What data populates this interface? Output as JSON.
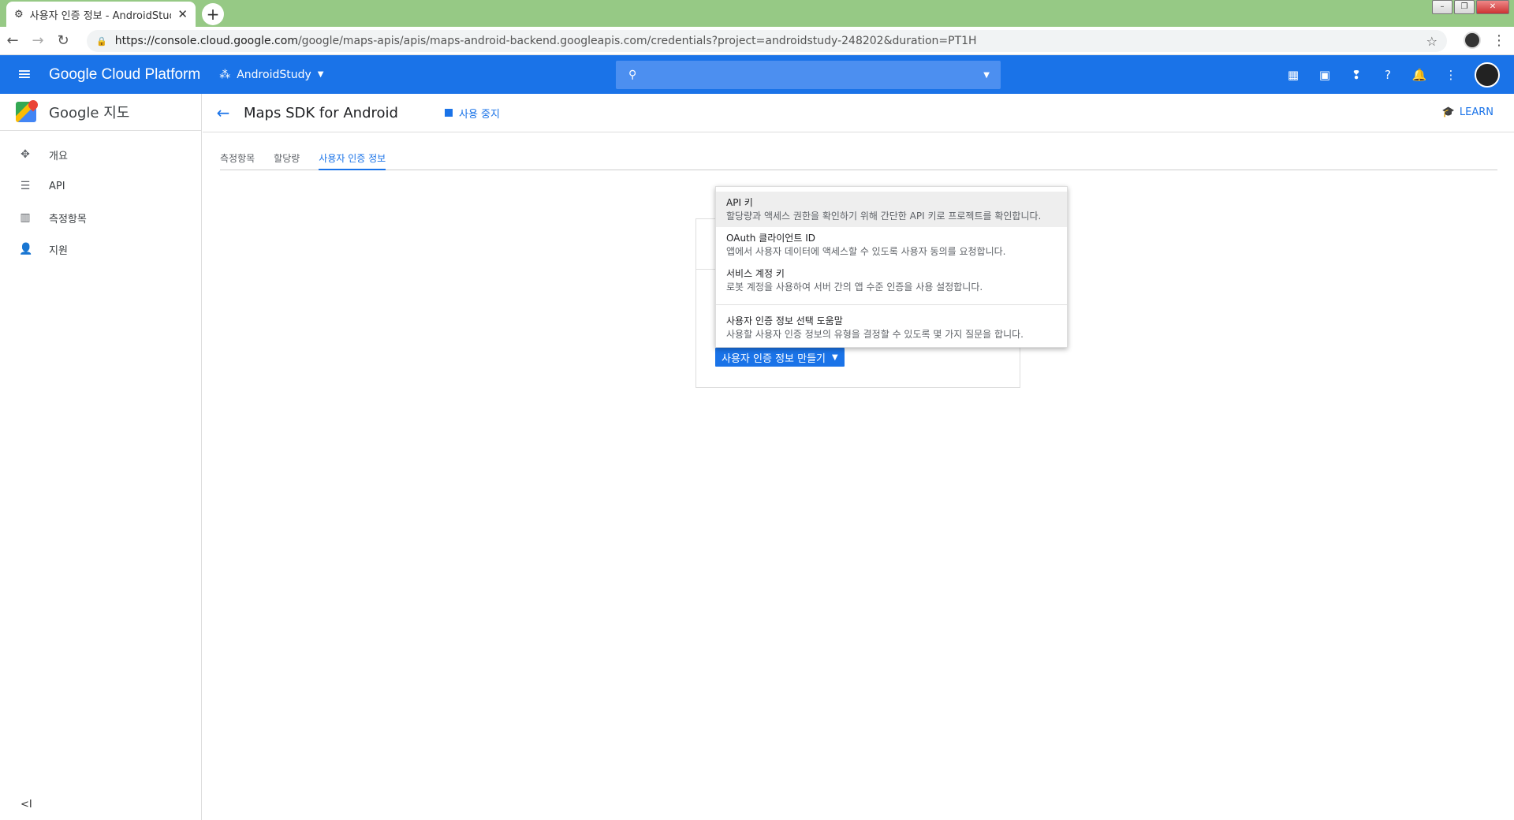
{
  "browser": {
    "tab_title": "사용자 인증 정보 - AndroidStud",
    "tab_close": "✕",
    "newtab": "+",
    "url_host": "https://console.cloud.google.com",
    "url_path": "/google/maps-apis/apis/maps-android-backend.googleapis.com/credentials?project=androidstudy-248202&duration=PT1H"
  },
  "header": {
    "title": "Google Cloud Platform",
    "project": "AndroidStudy"
  },
  "sidebar": {
    "title": "Google 지도",
    "items": [
      {
        "label": "개요",
        "icon": "overview-icon"
      },
      {
        "label": "API",
        "icon": "list-icon"
      },
      {
        "label": "측정항목",
        "icon": "bar-chart-icon"
      },
      {
        "label": "지원",
        "icon": "person-icon"
      }
    ],
    "collapse": "<I"
  },
  "page": {
    "title": "Maps SDK for Android",
    "disable_label": "사용 중지",
    "learn_label": "LEARN",
    "tabs": [
      "측정항목",
      "할당량",
      "사용자 인증 정보"
    ],
    "active_tab": 2
  },
  "menu": {
    "items": [
      {
        "title": "API 키",
        "desc": "할당량과 액세스 권한을 확인하기 위해 간단한 API 키로 프로젝트를 확인합니다."
      },
      {
        "title": "OAuth 클라이언트 ID",
        "desc": "앱에서 사용자 데이터에 액세스할 수 있도록 사용자 동의를 요청합니다."
      },
      {
        "title": "서비스 계정 키",
        "desc": "로봇 계정을 사용하여 서버 간의 앱 수준 인증을 사용 설정합니다."
      },
      {
        "title": "사용자 인증 정보 선택 도움말",
        "desc": "사용할 사용자 인증 정보의 유형을 결정할 수 있도록 몇 가지 질문을 합니다."
      }
    ]
  },
  "create_button": "사용자 인증 정보 만들기",
  "colors": {
    "accent": "#1a73e8",
    "tabstrip": "#96c985"
  }
}
